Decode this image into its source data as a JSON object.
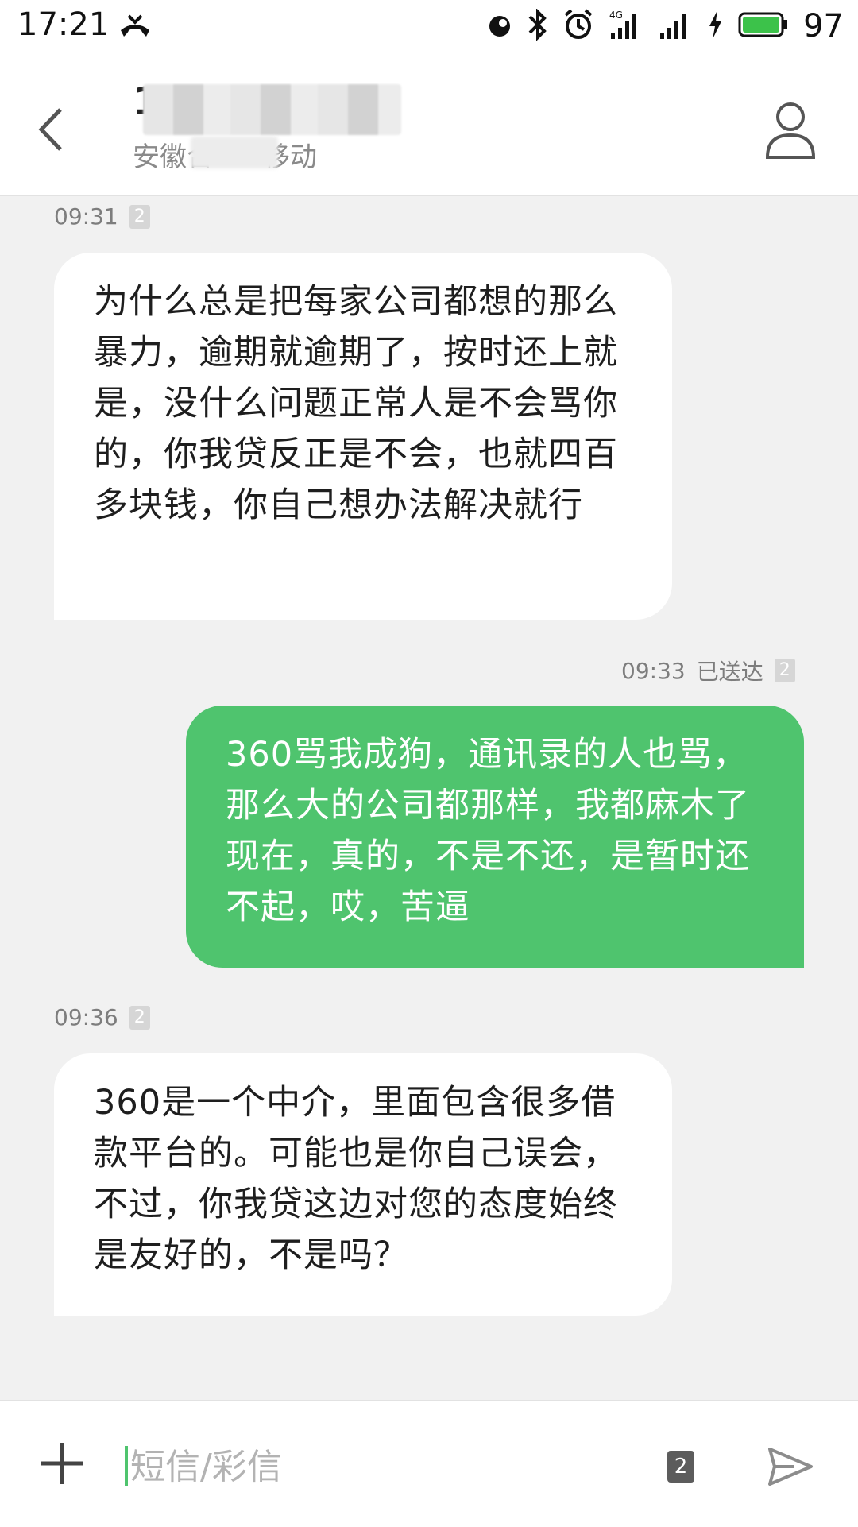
{
  "status_bar": {
    "time": "17:21",
    "battery": "97",
    "network": "4G",
    "icons": [
      "missed-call-icon",
      "hd-call-icon",
      "bluetooth-icon",
      "alarm-icon",
      "signal-icon",
      "signal-icon",
      "charging-icon",
      "battery-icon"
    ]
  },
  "header": {
    "title": "1",
    "subtitle": "安徽合",
    "subtitle_tail": "移动"
  },
  "messages": [
    {
      "direction": "incoming",
      "time": "09:31",
      "sim": "2",
      "text": "为什么总是把每家公司都想的那么暴力，逾期就逾期了，按时还上就是，没什么问题正常人是不会骂你的，你我贷反正是不会，也就四百多块钱，你自己想办法解决就行"
    },
    {
      "direction": "outgoing",
      "time": "09:33",
      "status": "已送达",
      "sim": "2",
      "text": "360骂我成狗，通讯录的人也骂，那么大的公司都那样，我都麻木了现在，真的，不是不还，是暂时还不起，哎，苦逼"
    },
    {
      "direction": "incoming",
      "time": "09:36",
      "sim": "2",
      "text": "360是一个中介，里面包含很多借款平台的。可能也是你自己误会，不过，你我贷这边对您的态度始终是友好的，不是吗？"
    }
  ],
  "composer": {
    "placeholder": "短信/彩信",
    "sim": "2"
  },
  "colors": {
    "outgoing_bubble": "#4fc46e",
    "incoming_bubble": "#ffffff",
    "background": "#f1f1f1"
  }
}
